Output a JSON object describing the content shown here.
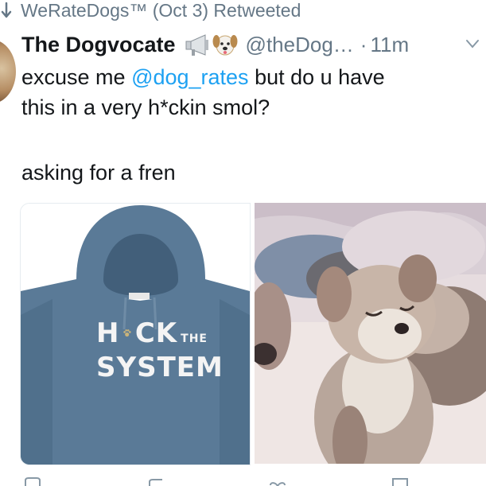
{
  "retweet": {
    "icon": "retweet-arrow-icon",
    "label": "WeRateDogs™ (Oct 3) Retweeted"
  },
  "tweet": {
    "display_name": "The Dogvocate",
    "emoji": [
      "megaphone-icon",
      "dog-face-icon"
    ],
    "handle": "@theDog…",
    "separator": "·",
    "time": "11m",
    "line1_before": "excuse me ",
    "mention": "@dog_rates",
    "line1_after": " but do u have",
    "line2": "this in a very h*ckin smol?",
    "line3": "asking for a fren"
  },
  "media": {
    "hoodie_print": {
      "line1_a": "H",
      "line1_b": "CK",
      "line1_small": "THE",
      "line2": "SYSTEM"
    },
    "left_image": "hoodie-photo",
    "right_image": "puppy-photo"
  },
  "colors": {
    "text": "#14171a",
    "secondary": "#657786",
    "link": "#1da1f2",
    "hoodie": "#5a7a97"
  },
  "actions": [
    "reply-icon",
    "retweet-icon",
    "like-icon",
    "message-icon"
  ]
}
